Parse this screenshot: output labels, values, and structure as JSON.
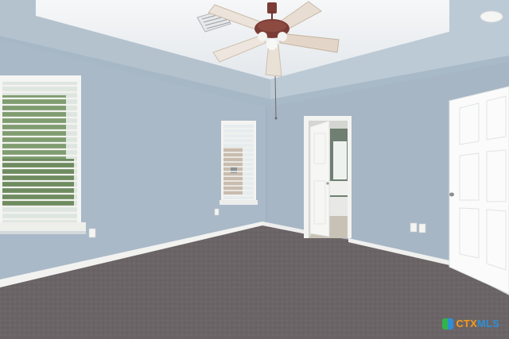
{
  "photo": {
    "subject": "empty-bedroom",
    "colors": {
      "wall": "#a9b9c8",
      "wall_shadow": "#9db0c1",
      "ceiling": "#f2f4f6",
      "tray_edge": "#b7c4cf",
      "carpet": "#6b6466",
      "baseboard": "#f4f4f2",
      "door": "#fbfbfb",
      "fan_wood": "#7a3c35",
      "blade": "#e8ddd3"
    }
  },
  "watermark": {
    "prefix": "CTX",
    "suffix": "MLS"
  }
}
